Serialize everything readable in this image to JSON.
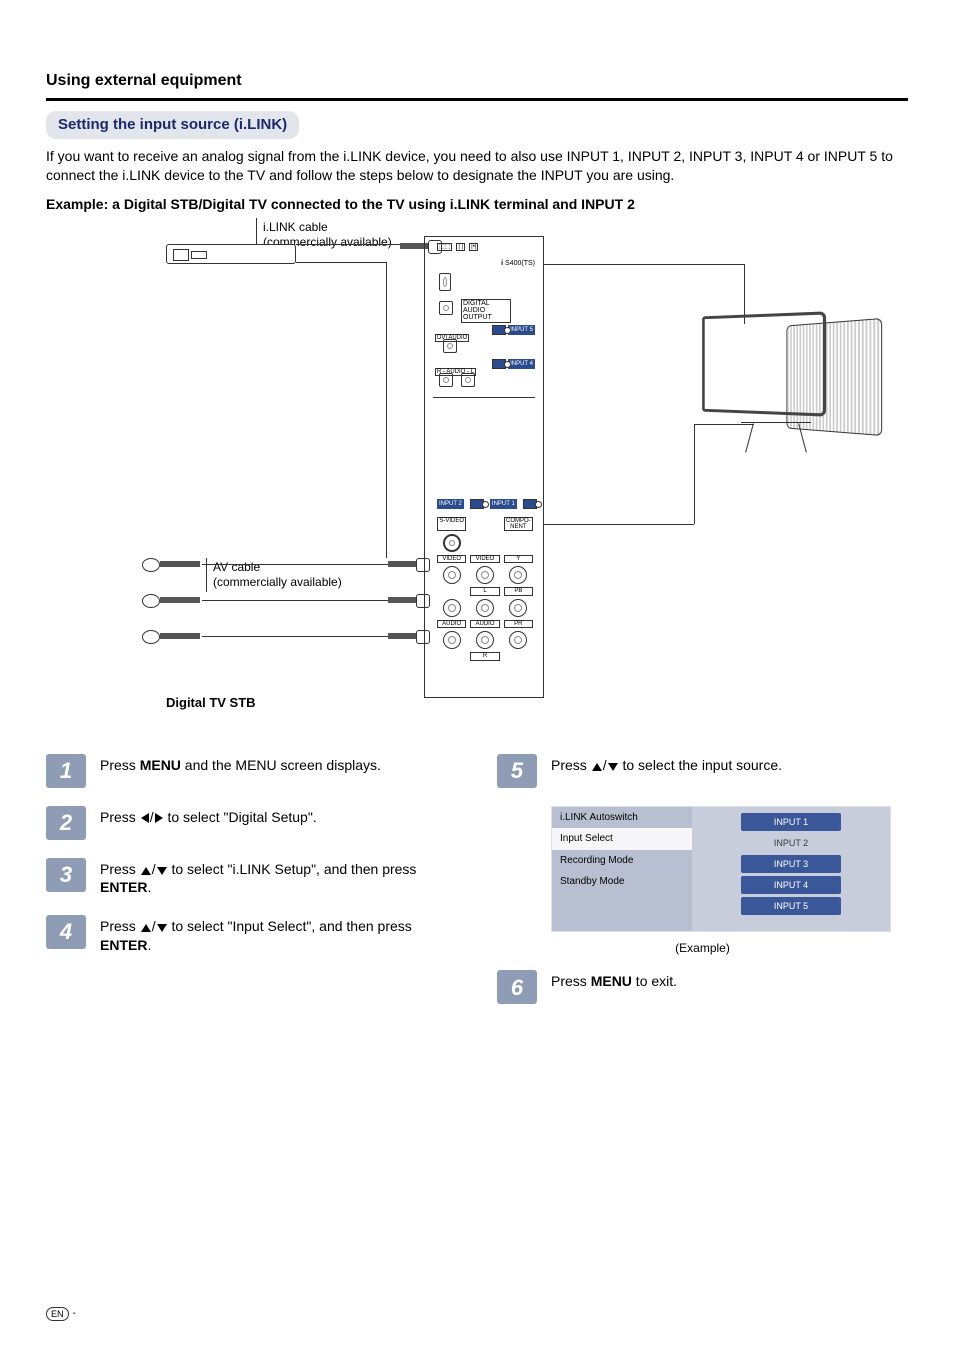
{
  "heading": "Using external equipment",
  "subheading": "Setting the input source (i.LINK)",
  "intro": "If you want to receive an analog signal from the i.LINK device, you need to also use INPUT 1, INPUT 2, INPUT 3, INPUT 4 or INPUT 5 to connect the i.LINK device to the TV and follow the steps below to designate the INPUT you are using.",
  "example_line": "Example: a Digital STB/Digital TV connected to the TV using i.LINK terminal and INPUT 2",
  "diagram": {
    "ilink_cable_l1": "i.LINK cable",
    "ilink_cable_l2": "(commercially available)",
    "av_cable_l1": "AV cable",
    "av_cable_l2": "(commercially available)",
    "digital_stb": "Digital TV STB",
    "panel": {
      "s400": "S400(TS)",
      "digital_audio": "DIGITAL AUDIO OUTPUT",
      "dvi_audio": "DVI AUDIO",
      "r_audio_l": "R - AUDIO - L",
      "input5": "INPUT 5",
      "input4": "INPUT 4",
      "input2": "INPUT 2",
      "input1": "INPUT 1",
      "svideo": "S-VIDEO",
      "component": "COMPO-NENT",
      "video": "VIDEO",
      "audio": "AUDIO",
      "L": "L",
      "R": "R",
      "Y": "Y",
      "Pb": "PB",
      "Pr": "PR"
    }
  },
  "steps": {
    "s1": {
      "num": "1",
      "pre": "Press ",
      "b1": "MENU",
      "post": " and the MENU screen displays."
    },
    "s2": {
      "num": "2",
      "pre": "Press ",
      "mid": " to select \"Digital Setup\"."
    },
    "s3": {
      "num": "3",
      "pre": "Press ",
      "mid_a": " to select \"i.LINK Setup\", and then press ",
      "b1": "ENTER",
      "post": "."
    },
    "s4": {
      "num": "4",
      "pre": "Press ",
      "mid_a": " to select \"Input Select\", and then press ",
      "b1": "ENTER",
      "post": "."
    },
    "s5": {
      "num": "5",
      "pre": "Press ",
      "mid": " to select the input source."
    },
    "s6": {
      "num": "6",
      "pre": "Press ",
      "b1": "MENU",
      "post": " to exit."
    }
  },
  "osd": {
    "left": {
      "r1": "i.LINK Autoswitch",
      "r2": "Input Select",
      "r3": "Recording Mode",
      "r4": "Standby Mode"
    },
    "right": {
      "b1": "INPUT 1",
      "b2": "INPUT 2",
      "b3": "INPUT 3",
      "b4": "INPUT 4",
      "b5": "INPUT 5"
    },
    "caption": "(Example)"
  },
  "footer": {
    "lang": "EN",
    "dash": "-"
  }
}
